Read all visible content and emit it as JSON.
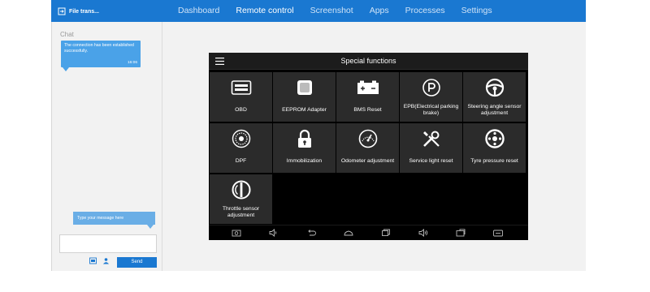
{
  "app": {
    "brand_label": "File trans...",
    "nav": [
      "Dashboard",
      "Remote control",
      "Screenshot",
      "Apps",
      "Processes",
      "Settings"
    ],
    "active_nav": "Remote control"
  },
  "chat": {
    "title": "Chat",
    "message": "The connection has been established successfully.",
    "message_time": "16:06",
    "compose_hint": "Type your message here",
    "input_value": "",
    "send_label": "Send"
  },
  "device": {
    "header_title": "Special functions",
    "tiles": [
      {
        "label": "OBD",
        "icon": "obd-icon"
      },
      {
        "label": "EEPROM Adapter",
        "icon": "eeprom-icon"
      },
      {
        "label": "BMS Reset",
        "icon": "battery-icon"
      },
      {
        "label": "EPB(Electrical parking brake)",
        "icon": "parking-brake-icon"
      },
      {
        "label": "Steering angle sensor adjustment",
        "icon": "steering-wheel-icon"
      },
      {
        "label": "DPF",
        "icon": "dpf-icon"
      },
      {
        "label": "Immobilization",
        "icon": "lock-icon"
      },
      {
        "label": "Odometer adjustment",
        "icon": "odometer-icon"
      },
      {
        "label": "Service light reset",
        "icon": "tools-icon"
      },
      {
        "label": "Tyre pressure reset",
        "icon": "tyre-icon"
      },
      {
        "label": "Throttle sensor adjustment",
        "icon": "throttle-icon"
      }
    ],
    "navbar_icons": [
      "camera-icon",
      "volume-down-icon",
      "back-icon",
      "home-icon",
      "recent-apps-icon",
      "volume-up-icon",
      "diagnostic-icon",
      "vci-icon"
    ]
  },
  "colors": {
    "topbar": "#1a78d1",
    "bubble": "#4aa2e8",
    "tile": "#2b2b2b",
    "screen": "#000000"
  }
}
